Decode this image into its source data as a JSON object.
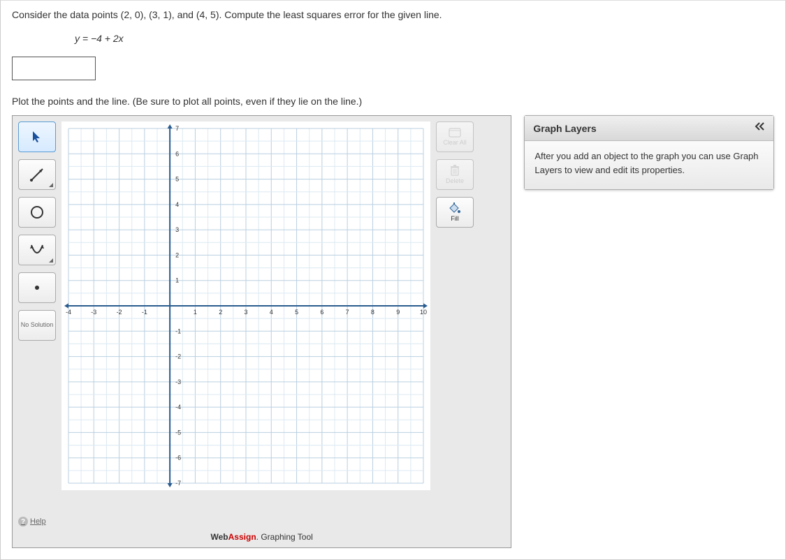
{
  "question": {
    "text": "Consider the data points (2, 0), (3, 1), and (4, 5). Compute the least squares error for the given line.",
    "equation": "y = −4 + 2x",
    "plot_instruction": "Plot the points and the line. (Be sure to plot all points, even if they lie on the line.)"
  },
  "toolbar": {
    "no_solution": "No Solution",
    "help": "Help"
  },
  "side_buttons": {
    "clear_all": "Clear All",
    "delete": "Delete",
    "fill": "Fill"
  },
  "layers_panel": {
    "title": "Graph Layers",
    "body": "After you add an object to the graph you can use Graph Layers to view and edit its properties."
  },
  "footer": {
    "brand_prefix": "Web",
    "brand_highlight": "Assign",
    "brand_suffix": ". Graphing Tool"
  },
  "chart_data": {
    "type": "scatter",
    "title": "",
    "xlabel": "",
    "ylabel": "",
    "xlim": [
      -4,
      10
    ],
    "ylim": [
      -7,
      7
    ],
    "xticks": [
      -4,
      -3,
      -2,
      -1,
      1,
      2,
      3,
      4,
      5,
      6,
      7,
      8,
      9,
      10
    ],
    "yticks": [
      -7,
      -6,
      -5,
      -4,
      -3,
      -2,
      -1,
      1,
      2,
      3,
      4,
      5,
      6,
      7
    ],
    "grid": true,
    "series": []
  }
}
